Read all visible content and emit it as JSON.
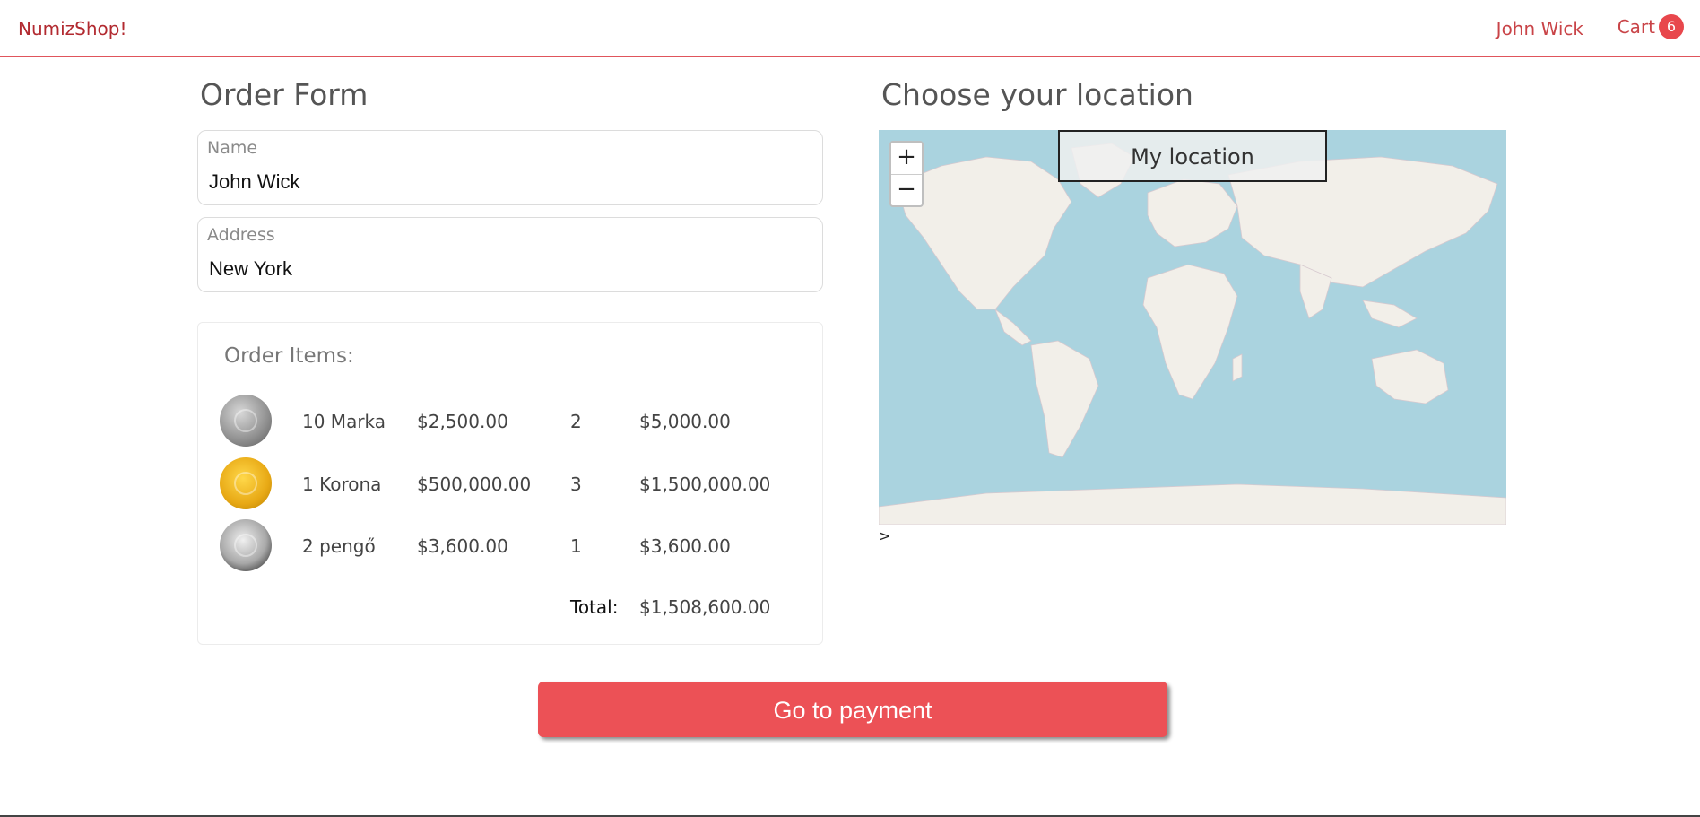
{
  "navbar": {
    "brand": "NumizShop!",
    "user": "John Wick",
    "cart_label": "Cart",
    "cart_count": "6"
  },
  "form": {
    "title": "Order Form",
    "name": {
      "label": "Name",
      "value": "John Wick"
    },
    "address": {
      "label": "Address",
      "value": "New York"
    }
  },
  "order_items": {
    "title": "Order Items:",
    "rows": [
      {
        "name": "10 Marka",
        "price": "$2,500.00",
        "qty": "2",
        "subtotal": "$5,000.00",
        "coin_icon": "silver-coin-icon"
      },
      {
        "name": "1 Korona",
        "price": "$500,000.00",
        "qty": "3",
        "subtotal": "$1,500,000.00",
        "coin_icon": "gold-coin-icon"
      },
      {
        "name": "2 pengő",
        "price": "$3,600.00",
        "qty": "1",
        "subtotal": "$3,600.00",
        "coin_icon": "grey-coin-icon"
      }
    ],
    "total_label": "Total:",
    "total_value": "$1,508,600.00"
  },
  "location": {
    "title": "Choose your location",
    "zoom_in": "+",
    "zoom_out": "−",
    "my_location": "My location",
    "trailing": ">"
  },
  "pay_button": "Go to payment",
  "colors": {
    "accent": "#ec5156",
    "brand": "#b22a30",
    "map_water": "#aad3df",
    "map_land": "#f2efe9"
  }
}
